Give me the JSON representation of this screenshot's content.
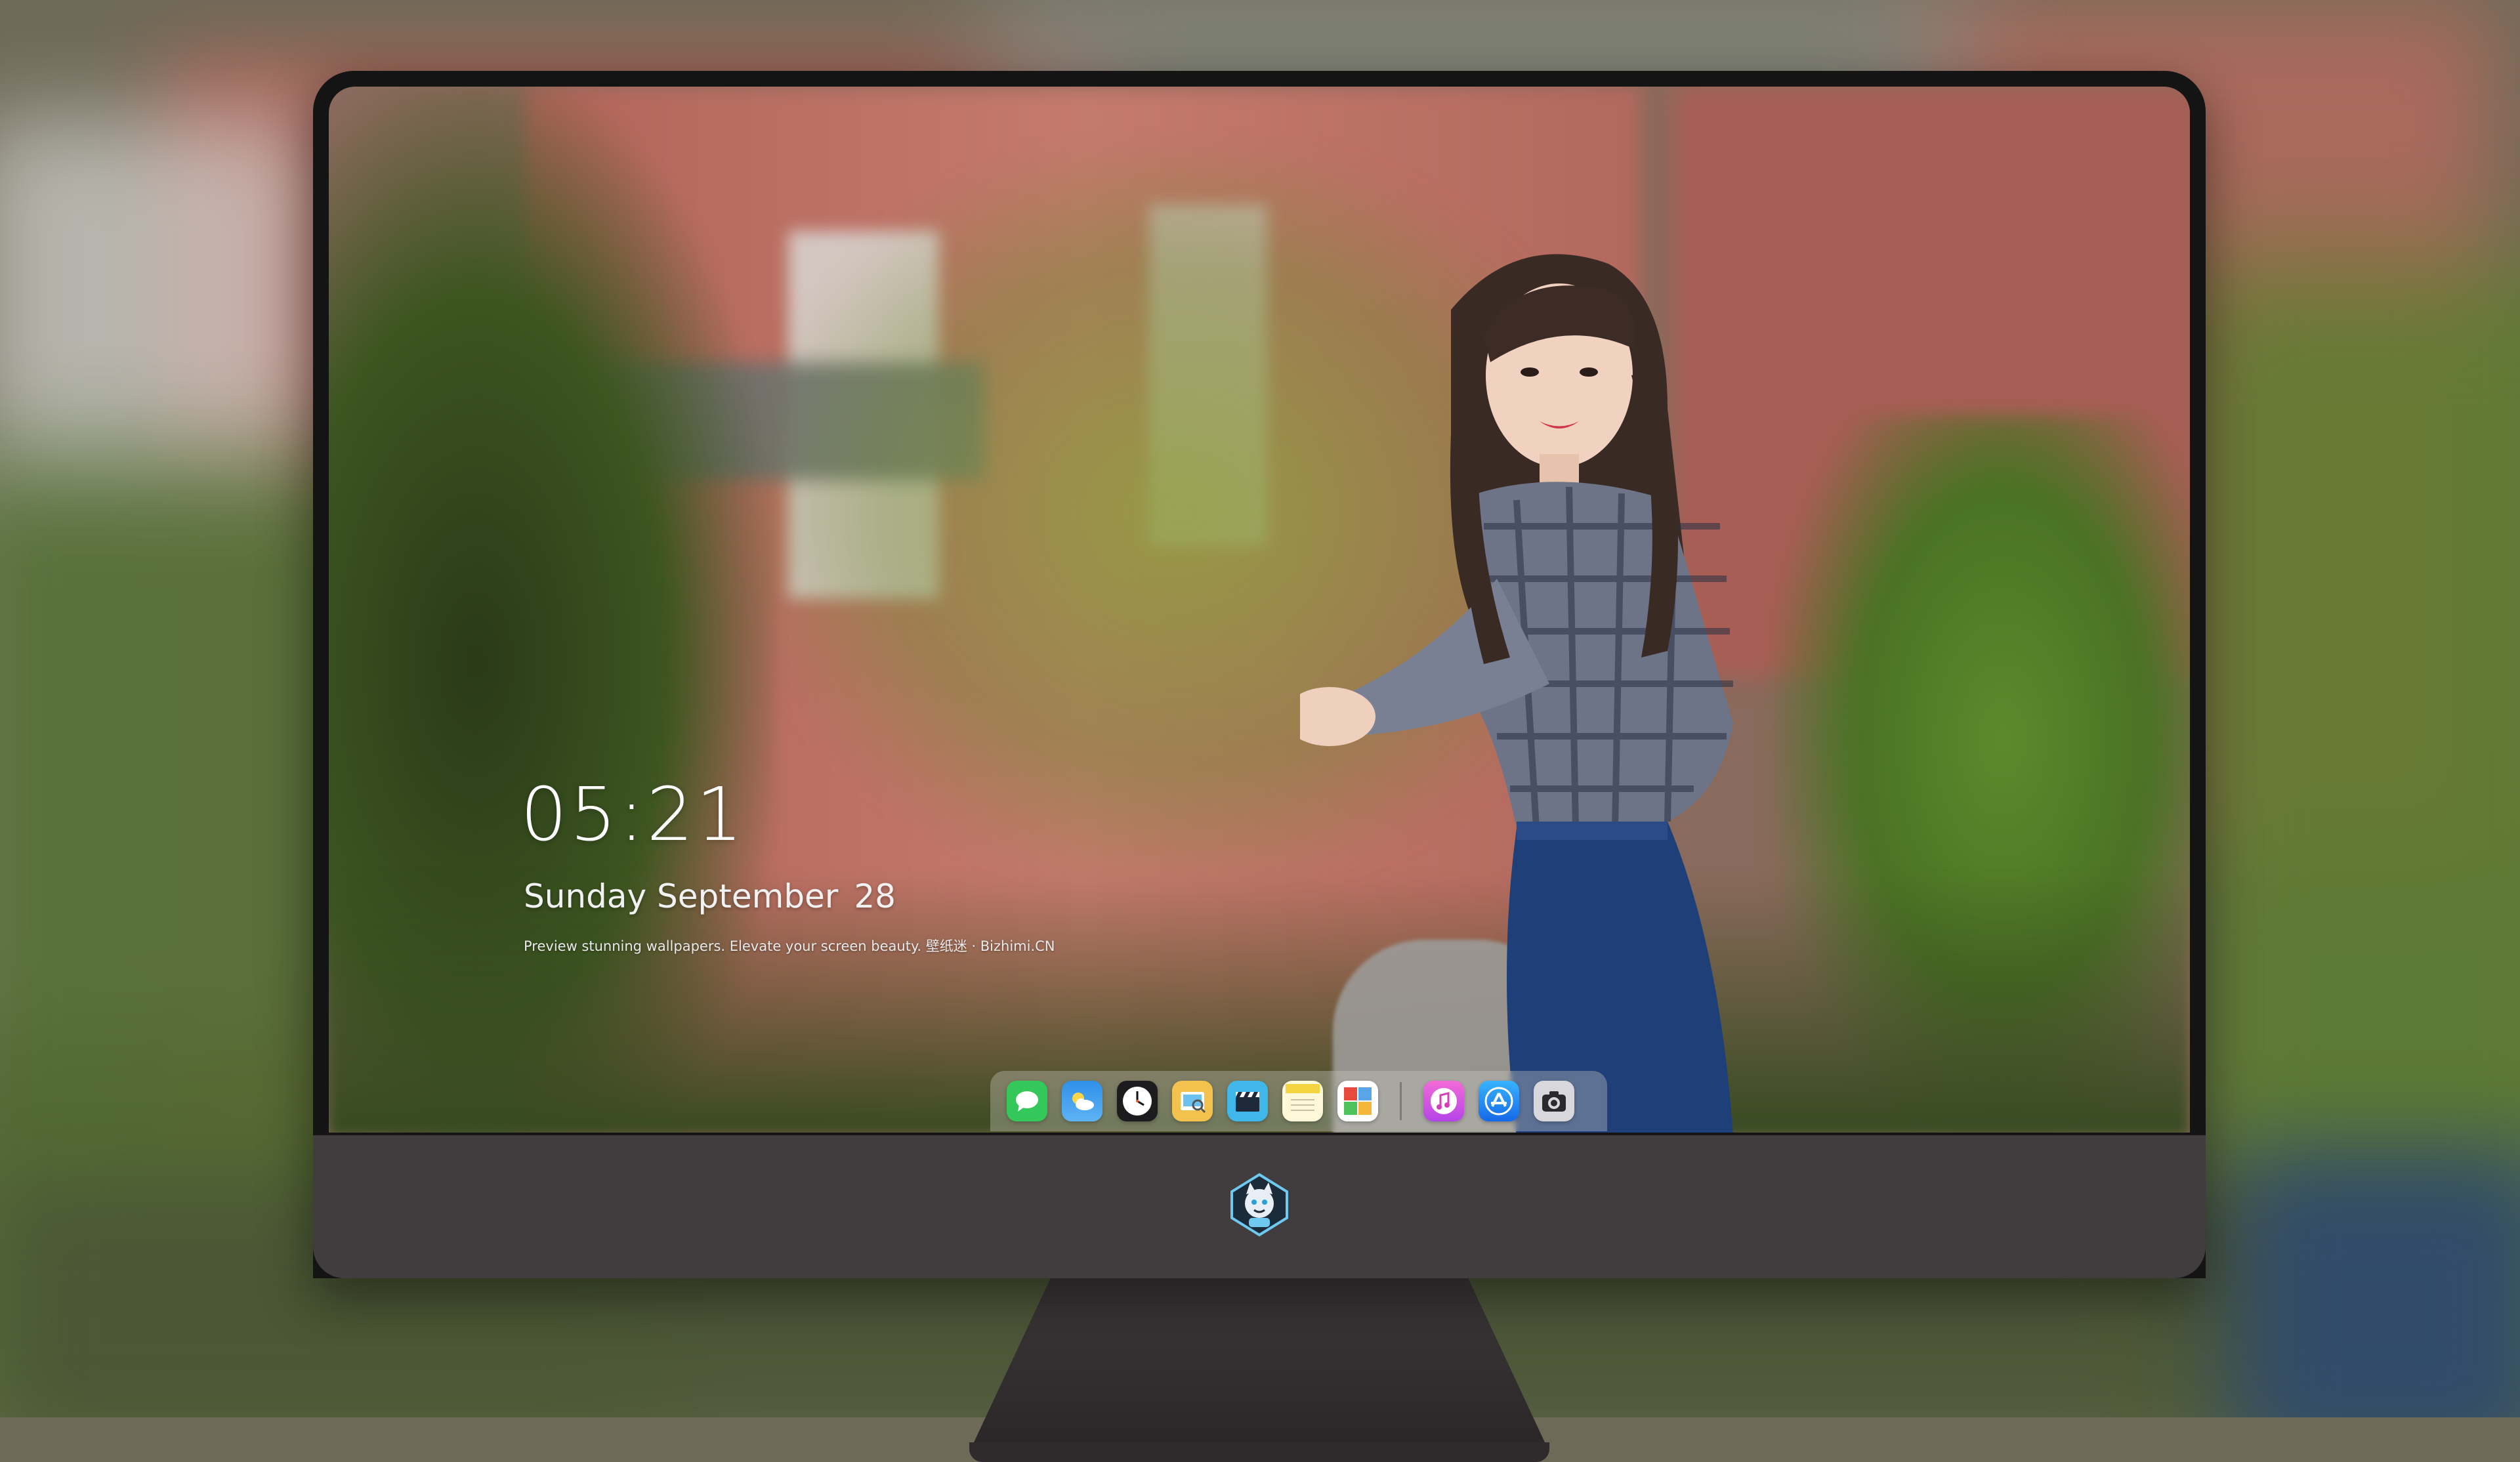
{
  "lock_screen": {
    "time": "05:21",
    "weekday": "Sunday",
    "month": "September",
    "day": "28",
    "tagline": "Preview stunning wallpapers. Elevate your screen beauty. 壁纸迷 · Bizhimi.CN"
  },
  "dock": {
    "apps": [
      {
        "name": "messages-icon",
        "color": "#34c759"
      },
      {
        "name": "weather-icon",
        "color": "#2f8fe8"
      },
      {
        "name": "clock-icon",
        "color": "#1c1c1e"
      },
      {
        "name": "preview-icon",
        "color": "#f2c14e"
      },
      {
        "name": "video-clapper-icon",
        "color": "#3fb7e8"
      },
      {
        "name": "notes-icon",
        "color": "#f5d442"
      },
      {
        "name": "photo-booth-icon",
        "color": "#5aa4e8"
      }
    ],
    "pinned": [
      {
        "name": "music-icon",
        "color": "#e84fc8"
      },
      {
        "name": "app-store-icon",
        "color": "#1e90f5"
      },
      {
        "name": "camera-icon",
        "color": "#8e8e93"
      }
    ]
  },
  "monitor": {
    "logo": "mascot-logo-icon",
    "bezel_color": "#141414",
    "chin_color": "#413c3e"
  }
}
